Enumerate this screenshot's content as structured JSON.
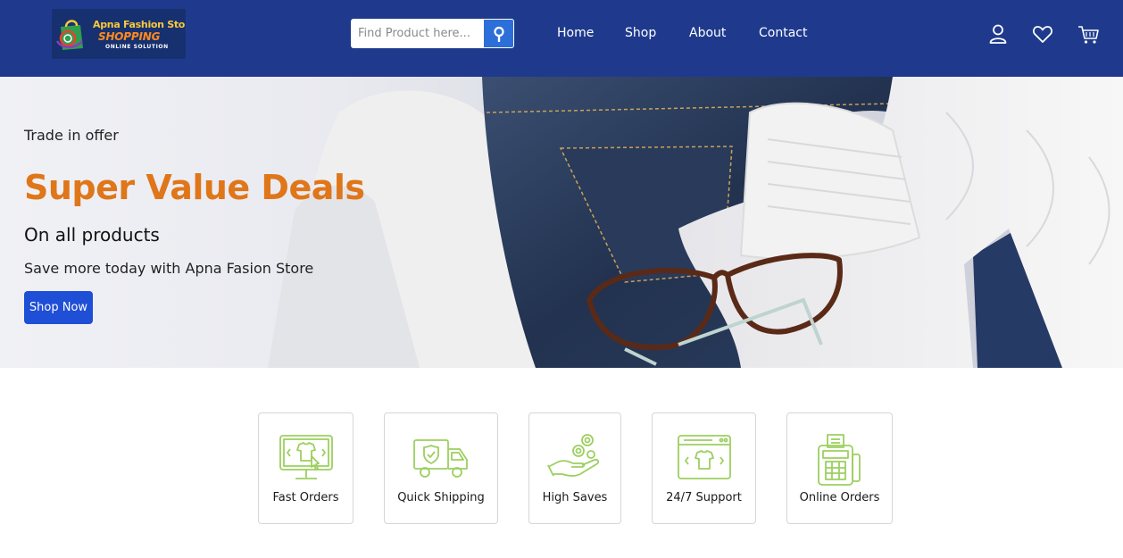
{
  "header": {
    "logo": {
      "line1": "Apna Fashion Store",
      "line2": "SHOPPING",
      "line3": "ONLINE SOLUTION"
    },
    "search": {
      "placeholder": "Find Product here...",
      "value": ""
    },
    "nav": [
      "Home",
      "Shop",
      "About",
      "Contact"
    ],
    "icons": [
      "user-icon",
      "heart-icon",
      "cart-icon"
    ],
    "background_color": "#1f3a8d"
  },
  "hero": {
    "kicker": "Trade in offer",
    "headline": "Super Value Deals",
    "subheadline": "On all products",
    "description": "Save more today with Apna Fasion Store",
    "cta_label": "Shop Now",
    "headline_color": "#e0761a",
    "cta_color": "#1f4fd6"
  },
  "features": [
    {
      "label": "Fast Orders",
      "icon": "monitor-tshirt-icon"
    },
    {
      "label": "Quick Shipping",
      "icon": "delivery-truck-icon"
    },
    {
      "label": "High Saves",
      "icon": "hand-coins-icon"
    },
    {
      "label": "24/7 Support",
      "icon": "browser-tshirt-icon"
    },
    {
      "label": "Online Orders",
      "icon": "payment-terminal-icon"
    }
  ],
  "feature_icon_color": "#9ccf5f"
}
